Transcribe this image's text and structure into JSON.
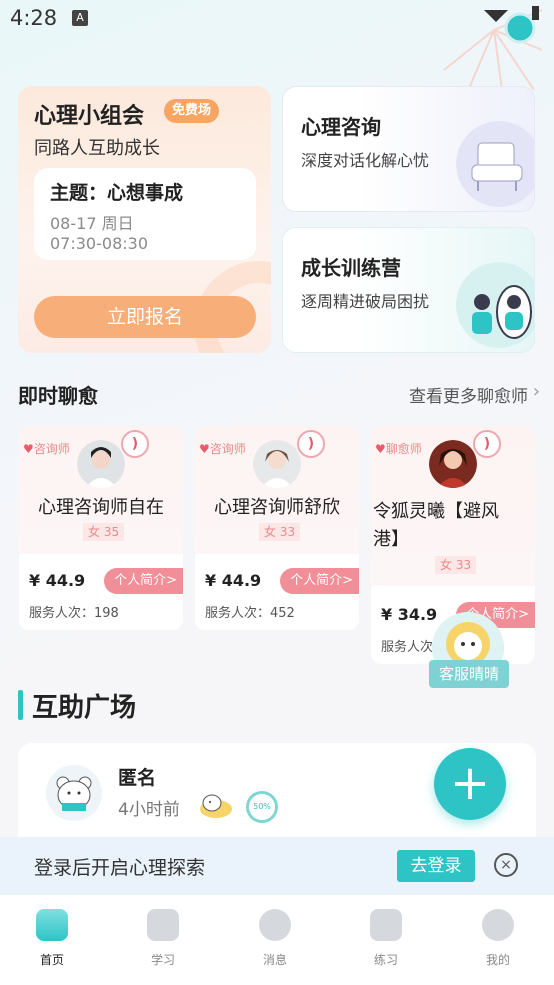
{
  "status_bar": {
    "time": "4:28",
    "notif_icon": "A"
  },
  "group_card": {
    "title": "心理小组会",
    "badge": "免费场",
    "subtitle": "同路人互助成长",
    "topic": "主题：心想事成",
    "date": "08-17 周日",
    "time": "07:30-08:30",
    "button": "立即报名"
  },
  "consult_card": {
    "title": "心理咨询",
    "subtitle": "深度对话化解心忧"
  },
  "camp_card": {
    "title": "成长训练营",
    "subtitle": "逐周精进破局困扰"
  },
  "chat_section": {
    "title": "即时聊愈",
    "more": "查看更多聊愈师"
  },
  "counselors": [
    {
      "badge": "咨询师",
      "name": "心理咨询师自在",
      "tag": "女 35",
      "price": "¥ 44.9",
      "intro": "个人简介>",
      "served": "服务人次：198"
    },
    {
      "badge": "咨询师",
      "name": "心理咨询师舒欣",
      "tag": "女 33",
      "price": "¥ 44.9",
      "intro": "个人简介>",
      "served": "服务人次：452"
    },
    {
      "badge": "聊愈师",
      "name_line1": "令狐灵曦【避风",
      "name_line2": "港】",
      "tag": "女 33",
      "price": "¥ 34.9",
      "intro": "个人简介>",
      "served": "服务人次"
    }
  ],
  "customer_service": {
    "label": "客服晴晴"
  },
  "plaza": {
    "title": "互助广场",
    "post": {
      "name": "匿名",
      "time": "4小时前",
      "progress": "50%"
    },
    "fab": "+"
  },
  "login_banner": {
    "text": "登录后开启心理探索",
    "button": "去登录",
    "close": "×"
  },
  "tabs": [
    {
      "label": "首页",
      "icon": "home-icon",
      "active": true
    },
    {
      "label": "学习",
      "icon": "book-icon",
      "active": false
    },
    {
      "label": "消息",
      "icon": "message-icon",
      "active": false
    },
    {
      "label": "练习",
      "icon": "calendar-icon",
      "active": false
    },
    {
      "label": "我的",
      "icon": "profile-icon",
      "active": false
    }
  ],
  "colors": {
    "accent": "#2ec4c6",
    "orange": "#f7ae78",
    "pink": "#f28e97"
  }
}
